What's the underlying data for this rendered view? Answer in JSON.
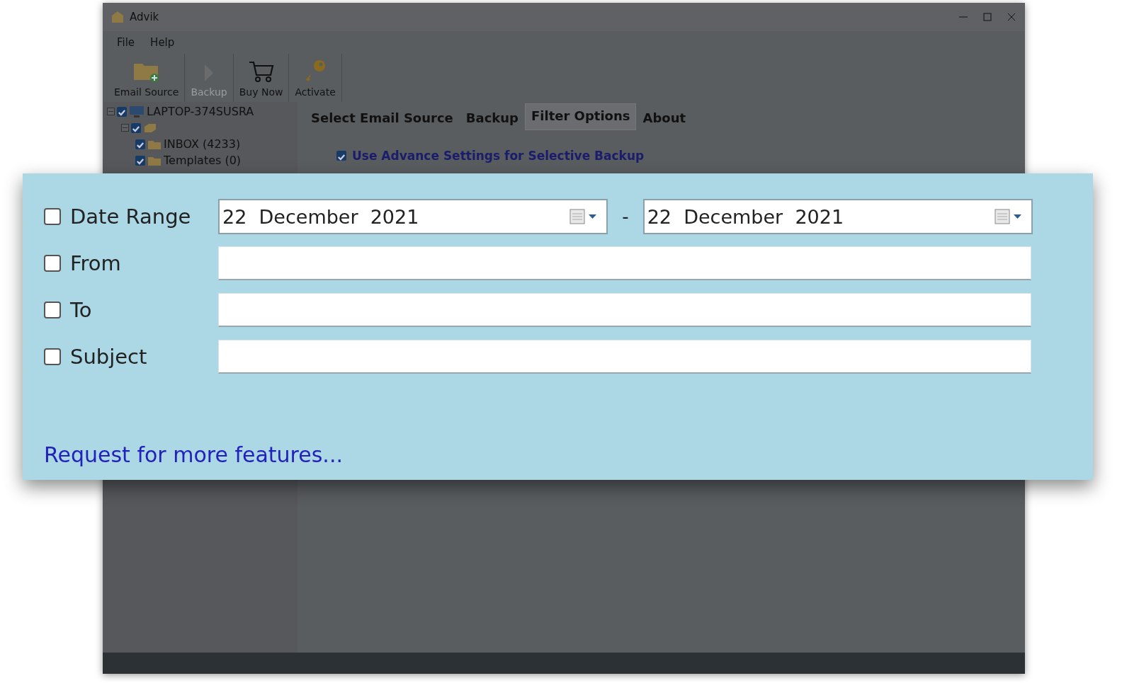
{
  "window": {
    "title": "Advik"
  },
  "menu": [
    {
      "label": "File"
    },
    {
      "label": "Help"
    }
  ],
  "toolbar": [
    {
      "label": "Email Source",
      "disabled": false
    },
    {
      "label": "Backup",
      "disabled": true
    },
    {
      "label": "Buy Now",
      "disabled": false
    },
    {
      "label": "Activate",
      "disabled": false
    }
  ],
  "tree": [
    {
      "label": "LAPTOP-374SUSRA",
      "checked": true,
      "expanded": true,
      "children": [
        {
          "checked": true,
          "expanded": true,
          "children": [
            {
              "label": "INBOX (4233)",
              "checked": true
            },
            {
              "label": "Templates (0)",
              "checked": true
            }
          ]
        }
      ]
    }
  ],
  "tabs": [
    {
      "label": "Select Email Source",
      "selected": false
    },
    {
      "label": "Backup",
      "selected": false
    },
    {
      "label": "Filter Options",
      "selected": true
    },
    {
      "label": "About",
      "selected": false
    }
  ],
  "advance_settings": {
    "label": "Use Advance Settings for Selective Backup",
    "checked": true
  },
  "filters": [
    {
      "kind": "date",
      "label": "Date Range",
      "checked": false,
      "start": "22  December  2021",
      "separator": "-",
      "end": "22  December  2021"
    },
    {
      "kind": "text",
      "label": "From",
      "checked": false
    },
    {
      "kind": "text",
      "label": "To",
      "checked": false
    },
    {
      "kind": "text",
      "label": "Subject",
      "checked": false
    }
  ],
  "link": "Request for more features..."
}
